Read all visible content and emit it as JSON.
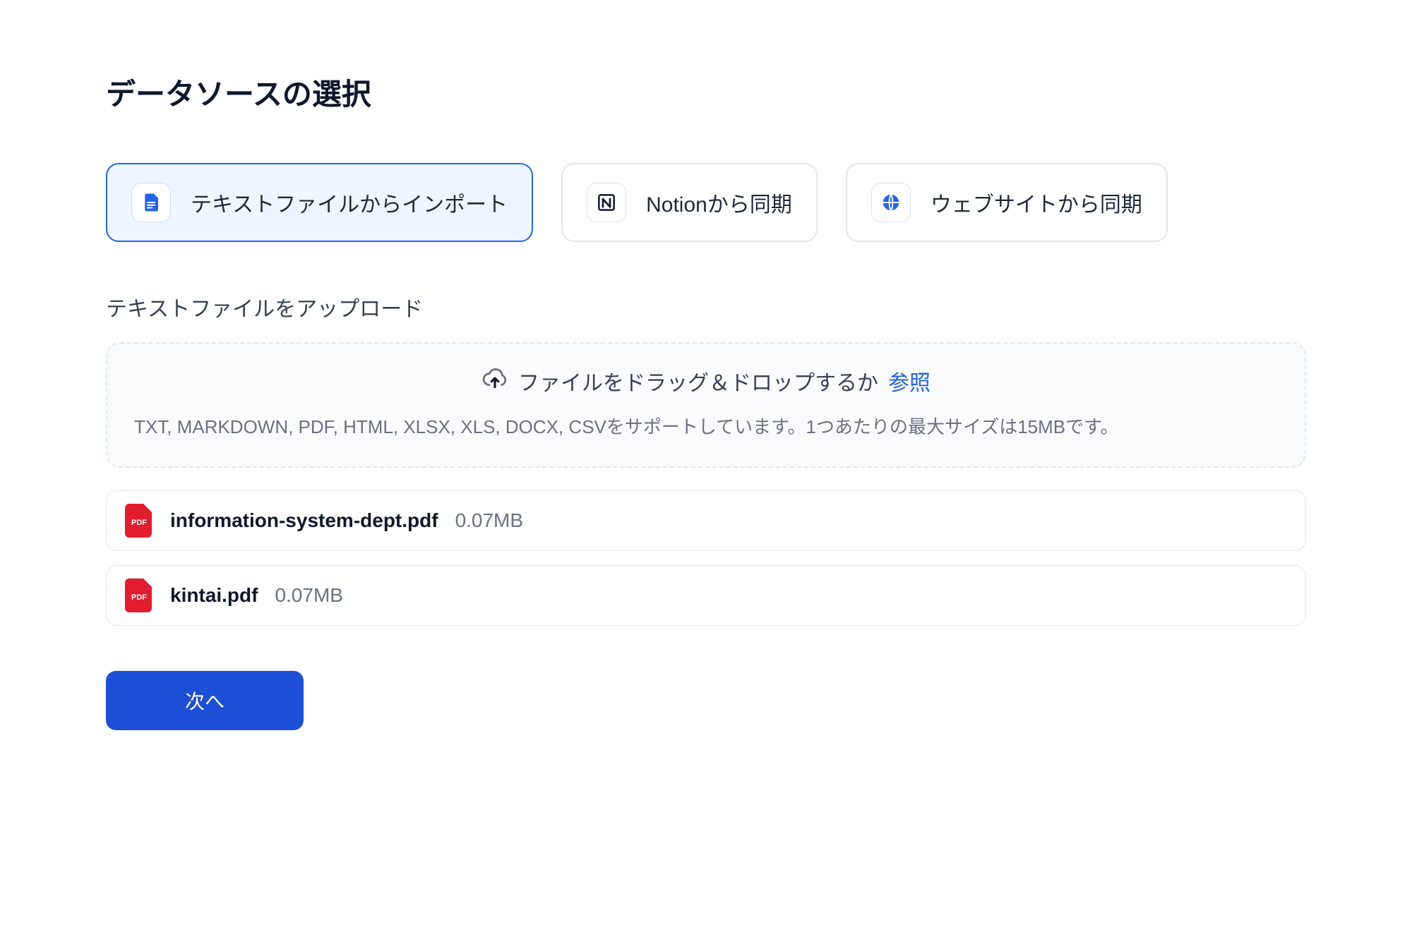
{
  "title": "データソースの選択",
  "sources": {
    "file": {
      "label": "テキストファイルからインポート",
      "selected": true
    },
    "notion": {
      "label": "Notionから同期",
      "selected": false
    },
    "web": {
      "label": "ウェブサイトから同期",
      "selected": false
    }
  },
  "upload": {
    "section_title": "テキストファイルをアップロード",
    "drag_text": "ファイルをドラッグ＆ドロップするか",
    "browse_label": "参照",
    "hint": "TXT, MARKDOWN, PDF, HTML, XLSX, XLS, DOCX, CSVをサポートしています。1つあたりの最大サイズは15MBです。"
  },
  "files": [
    {
      "name": "information-system-dept.pdf",
      "size": "0.07MB",
      "type": "pdf"
    },
    {
      "name": "kintai.pdf",
      "size": "0.07MB",
      "type": "pdf"
    }
  ],
  "actions": {
    "next": "次へ"
  },
  "colors": {
    "primary": "#1d4ed8",
    "accent": "#2563eb",
    "pdf_red": "#e11d2e"
  }
}
